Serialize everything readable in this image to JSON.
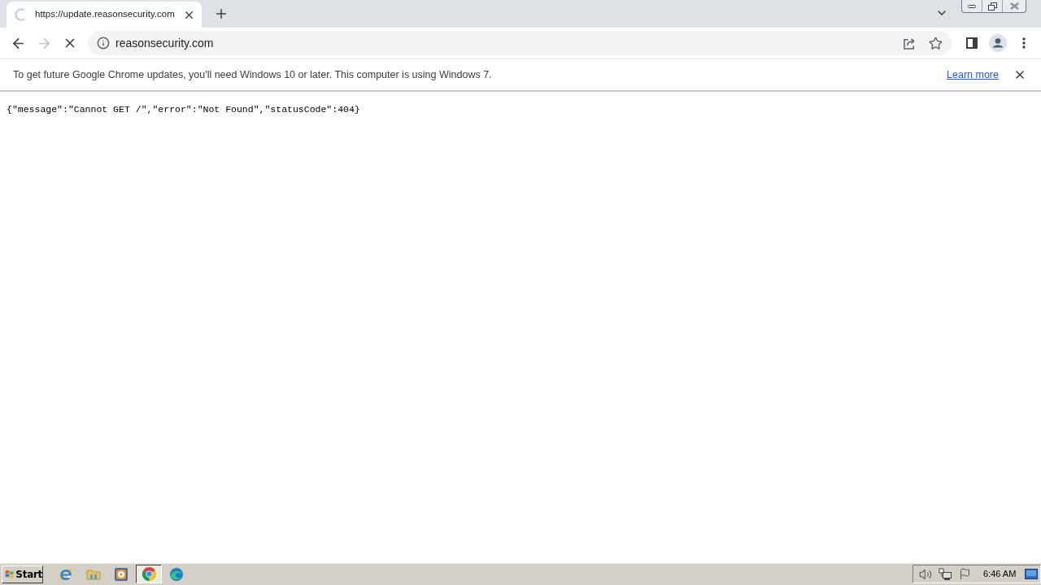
{
  "browser": {
    "tabs": [
      {
        "title": "https://update.reasonsecurity.com",
        "selected": true,
        "loading": true
      }
    ],
    "navigation": {
      "back_disabled": false,
      "forward_disabled": true,
      "loading": true
    },
    "address_bar": {
      "value": "reasonsecurity.com"
    }
  },
  "infobar": {
    "message": "To get future Google Chrome updates, you'll need Windows 10 or later. This computer is using Windows 7.",
    "link": "Learn more"
  },
  "page": {
    "body": "{\"message\":\"Cannot GET /\",\"error\":\"Not Found\",\"statusCode\":404}"
  },
  "taskbar": {
    "start": "Start",
    "apps": [
      {
        "kind": "ie",
        "selected": false
      },
      {
        "kind": "explorer",
        "selected": false
      },
      {
        "kind": "media_player",
        "selected": false
      },
      {
        "kind": "chrome",
        "selected": true
      },
      {
        "kind": "edge",
        "selected": false
      }
    ],
    "clock": "6:46 AM"
  }
}
